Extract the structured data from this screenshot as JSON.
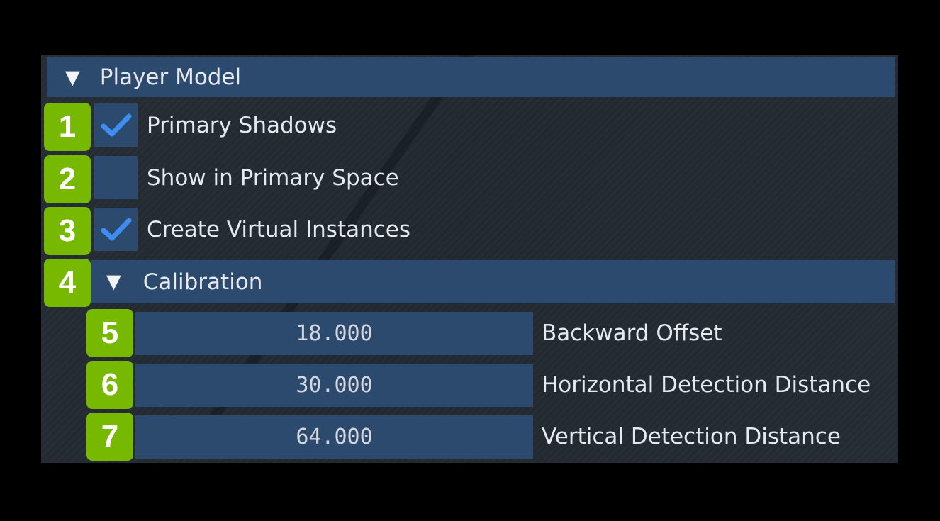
{
  "player_model": {
    "title": "Player Model",
    "expand_glyph": "▼",
    "toggles": [
      {
        "label": "Primary Shadows",
        "checked": true
      },
      {
        "label": "Show in Primary Space",
        "checked": false
      },
      {
        "label": "Create Virtual Instances",
        "checked": true
      }
    ]
  },
  "calibration": {
    "title": "Calibration",
    "expand_glyph": "▼",
    "fields": [
      {
        "value": "18.000",
        "label": "Backward Offset"
      },
      {
        "value": "30.000",
        "label": "Horizontal Detection Distance"
      },
      {
        "value": "64.000",
        "label": "Vertical Detection Distance"
      }
    ]
  },
  "badges": [
    "1",
    "2",
    "3",
    "4",
    "5",
    "6",
    "7"
  ],
  "colors": {
    "background": "#000000",
    "panel": "#242a31",
    "header": "#2c4a6e",
    "check": "#3d8ef0",
    "badge": "#76b900",
    "text": "#e6e9ee"
  }
}
